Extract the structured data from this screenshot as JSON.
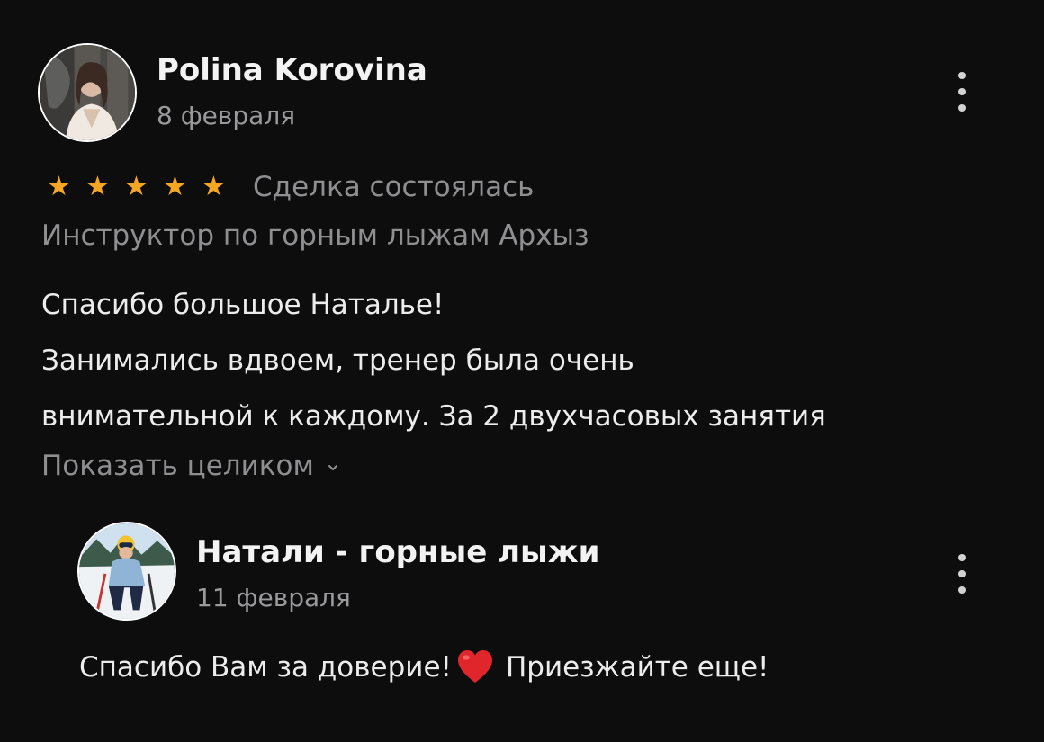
{
  "review": {
    "author_name": "Polina Korovina",
    "date": "8 февраля",
    "rating": 5,
    "stars": [
      "★",
      "★",
      "★",
      "★",
      "★"
    ],
    "deal_status": "Сделка состоялась",
    "service": "Инструктор по горным лыжам Архыз",
    "body_lines": [
      "Спасибо большое Наталье!",
      "Занимались вдвоем, тренер была очень",
      "внимательной к каждому. За 2 двухчасовых занятия"
    ],
    "expand_label": "Показать целиком",
    "menu_icon": "more-vertical-icon"
  },
  "reply": {
    "author_name": "Натали - горные лыжи",
    "date": "11 февраля",
    "text_before": "Спасибо Вам за доверие!",
    "text_after": "Приезжайте еще!",
    "emoji_icon": "red-heart-icon",
    "menu_icon": "more-vertical-icon"
  },
  "colors": {
    "background": "#0d0d0e",
    "primary_text": "#ececec",
    "secondary_text": "#8f8f91",
    "star": "#f5a623",
    "heart": "#e0252b"
  }
}
